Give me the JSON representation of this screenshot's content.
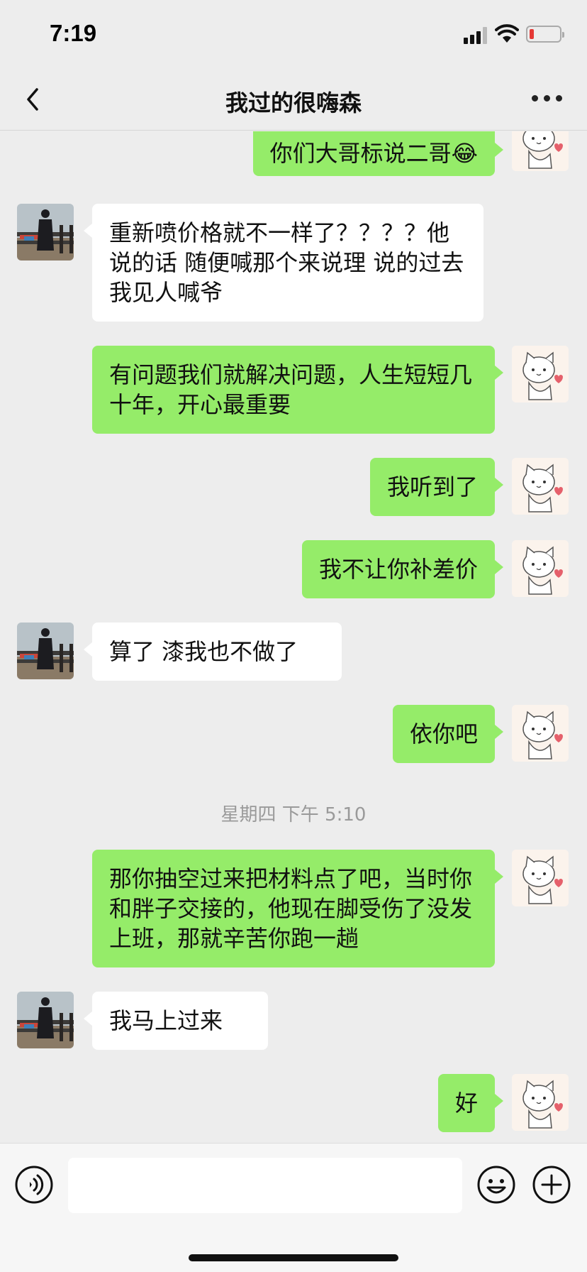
{
  "status_bar": {
    "time": "7:19"
  },
  "nav": {
    "title": "我过的很嗨森"
  },
  "messages": [
    {
      "side": "right",
      "text": "你们大哥标说二哥😂"
    },
    {
      "side": "left",
      "text": "重新喷价格就不一样了？？？？他说的话 随便喊那个来说理 说的过去 我见人喊爷"
    },
    {
      "side": "right",
      "text": "有问题我们就解决问题，人生短短几十年，开心最重要"
    },
    {
      "side": "right",
      "text": "我听到了"
    },
    {
      "side": "right",
      "text": "我不让你补差价"
    },
    {
      "side": "left",
      "text": "算了 漆我也不做了"
    },
    {
      "side": "right",
      "text": "依你吧"
    },
    {
      "side": "right",
      "text": "那你抽空过来把材料点了吧，当时你和胖子交接的，他现在脚受伤了没发上班，那就辛苦你跑一趟"
    },
    {
      "side": "left",
      "text": "我马上过来"
    },
    {
      "side": "right",
      "text": "好"
    }
  ],
  "timestamp": "星期四 下午 5:10",
  "input": {
    "value": "",
    "placeholder": ""
  },
  "icons": {
    "back": "chevron-left-icon",
    "more": "more-dots-icon",
    "voice": "voice-icon",
    "emoji": "emoji-icon",
    "plus": "plus-icon"
  },
  "colors": {
    "background": "#ededed",
    "bubble_self": "#95ec69",
    "bubble_other": "#ffffff",
    "battery_low": "#e53935"
  }
}
